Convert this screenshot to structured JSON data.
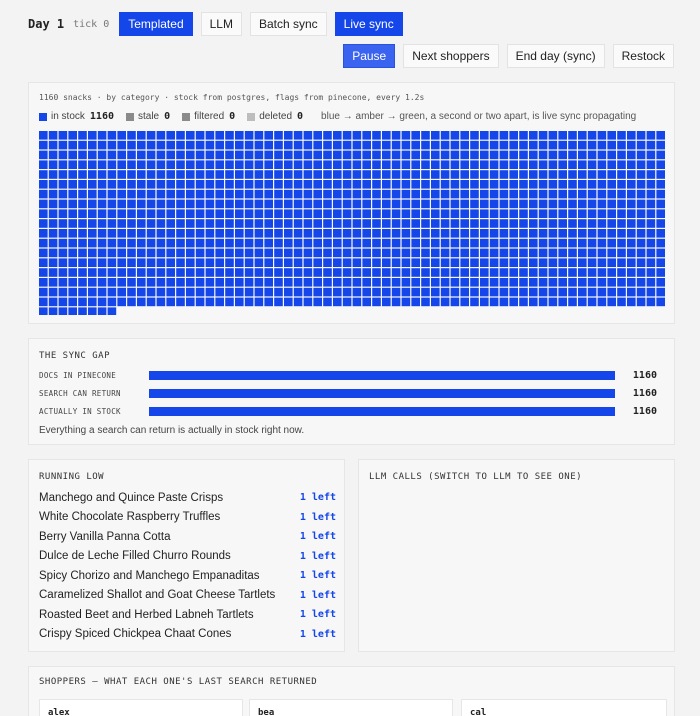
{
  "header": {
    "day_label": "Day 1",
    "tick_label": "tick 0",
    "modes": [
      {
        "label": "Templated",
        "active": true
      },
      {
        "label": "LLM",
        "active": false
      },
      {
        "label": "Batch sync",
        "active": false
      },
      {
        "label": "Live sync",
        "active": true
      }
    ]
  },
  "actions": {
    "pause_label": "Pause",
    "next_shoppers_label": "Next shoppers",
    "end_day_label": "End day (sync)",
    "restock_label": "Restock"
  },
  "grid": {
    "caption": "1160 snacks · by category · stock from postgres, flags from pinecone, every 1.2s",
    "total": 1160,
    "legend": [
      {
        "label": "in stock",
        "count": "1160",
        "color": "#1446ea"
      },
      {
        "label": "stale",
        "count": "0",
        "color": "#8a8a8a"
      },
      {
        "label": "filtered",
        "count": "0",
        "color": "#8a8a8a"
      },
      {
        "label": "deleted",
        "count": "0",
        "color": "#bdbdbd"
      }
    ],
    "note": "blue → amber → green, a second or two apart, is live sync propagating",
    "in_stock_color": "#1446ea"
  },
  "sync_gap": {
    "title": "THE SYNC GAP",
    "rows": [
      {
        "label": "DOCS IN PINECONE",
        "value": "1160",
        "fraction": 1.0
      },
      {
        "label": "SEARCH CAN RETURN",
        "value": "1160",
        "fraction": 1.0
      },
      {
        "label": "ACTUALLY IN STOCK",
        "value": "1160",
        "fraction": 1.0
      }
    ],
    "note": "Everything a search can return is actually in stock right now."
  },
  "running_low": {
    "title": "RUNNING LOW",
    "items": [
      {
        "name": "Manchego and Quince Paste Crisps",
        "left": "1 left"
      },
      {
        "name": "White Chocolate Raspberry Truffles",
        "left": "1 left"
      },
      {
        "name": "Berry Vanilla Panna Cotta",
        "left": "1 left"
      },
      {
        "name": "Dulce de Leche Filled Churro Rounds",
        "left": "1 left"
      },
      {
        "name": "Spicy Chorizo and Manchego Empanaditas",
        "left": "1 left"
      },
      {
        "name": "Caramelized Shallot and Goat Cheese Tartlets",
        "left": "1 left"
      },
      {
        "name": "Roasted Beet and Herbed Labneh Tartlets",
        "left": "1 left"
      },
      {
        "name": "Crispy Spiced Chickpea Chaat Cones",
        "left": "1 left"
      }
    ]
  },
  "llm_calls": {
    "title": "LLM CALLS (SWITCH TO LLM TO SEE ONE)"
  },
  "shoppers": {
    "title": "SHOPPERS — WHAT EACH ONE'S LAST SEARCH RETURNED",
    "names": [
      "alex",
      "bea",
      "cal"
    ]
  }
}
